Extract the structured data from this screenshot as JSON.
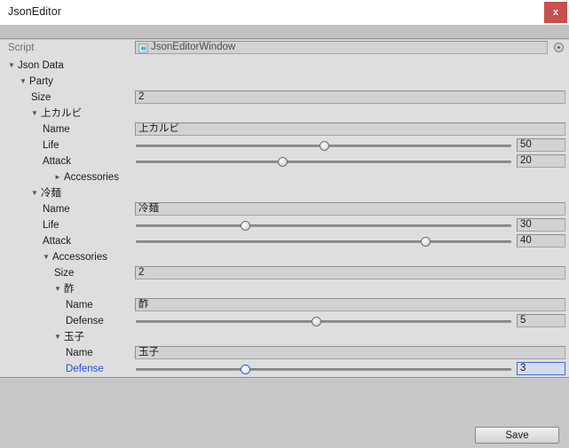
{
  "window": {
    "title": "JsonEditor",
    "close_label": "x"
  },
  "script_row": {
    "label": "Script",
    "value": "JsonEditorWindow",
    "icon": "cs-script-icon",
    "picker_icon": "object-picker-icon"
  },
  "footer": {
    "save_label": "Save"
  },
  "colors": {
    "accent": "#1f52cf",
    "close": "#c8504d",
    "panel": "#dedede",
    "chrome": "#c8c8c8"
  },
  "tree": {
    "rows": [
      {
        "label": "Json Data",
        "indent": 0,
        "foldout": "expanded",
        "type": "foldout"
      },
      {
        "label": "Party",
        "indent": 1,
        "foldout": "expanded",
        "type": "foldout"
      },
      {
        "label": "Size",
        "indent": 2,
        "foldout": "none",
        "type": "text",
        "value": "2"
      },
      {
        "label": "上カルビ",
        "indent": 2,
        "foldout": "expanded",
        "type": "foldout"
      },
      {
        "label": "Name",
        "indent": 3,
        "foldout": "none",
        "type": "text",
        "value": "上カルビ"
      },
      {
        "label": "Life",
        "indent": 3,
        "foldout": "none",
        "type": "slider",
        "value": "50",
        "percent": 50
      },
      {
        "label": "Attack",
        "indent": 3,
        "foldout": "none",
        "type": "slider",
        "value": "20",
        "percent": 39
      },
      {
        "label": "Accessories",
        "indent": 4,
        "foldout": "collapsed",
        "type": "foldout"
      },
      {
        "label": "冷麺",
        "indent": 2,
        "foldout": "expanded",
        "type": "foldout"
      },
      {
        "label": "Name",
        "indent": 3,
        "foldout": "none",
        "type": "text",
        "value": "冷麺"
      },
      {
        "label": "Life",
        "indent": 3,
        "foldout": "none",
        "type": "slider",
        "value": "30",
        "percent": 29
      },
      {
        "label": "Attack",
        "indent": 3,
        "foldout": "none",
        "type": "slider",
        "value": "40",
        "percent": 77
      },
      {
        "label": "Accessories",
        "indent": 3,
        "foldout": "expanded",
        "type": "foldout"
      },
      {
        "label": "Size",
        "indent": 4,
        "foldout": "none",
        "type": "text",
        "value": "2"
      },
      {
        "label": "酢",
        "indent": 4,
        "foldout": "expanded",
        "type": "foldout"
      },
      {
        "label": "Name",
        "indent": 5,
        "foldout": "none",
        "type": "text",
        "value": "酢"
      },
      {
        "label": "Defense",
        "indent": 5,
        "foldout": "none",
        "type": "slider",
        "value": "5",
        "percent": 48
      },
      {
        "label": "玉子",
        "indent": 4,
        "foldout": "expanded",
        "type": "foldout"
      },
      {
        "label": "Name",
        "indent": 5,
        "foldout": "none",
        "type": "text",
        "value": "玉子"
      },
      {
        "label": "Defense",
        "indent": 5,
        "foldout": "none",
        "type": "slider",
        "value": "3",
        "percent": 29,
        "selected": true
      }
    ]
  }
}
